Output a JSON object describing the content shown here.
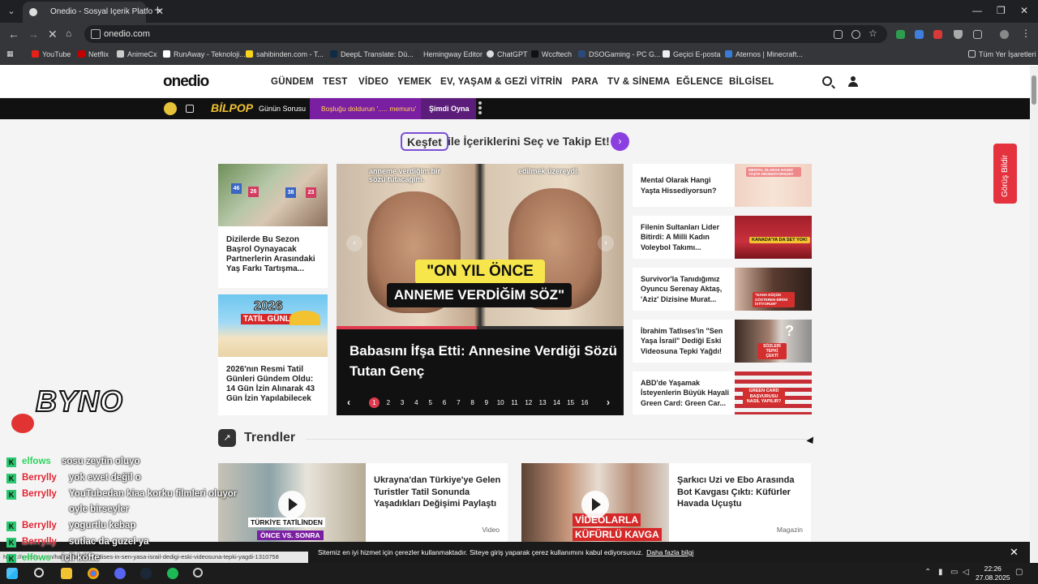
{
  "browser": {
    "tab_title": "Onedio - Sosyal İçerik Platformu",
    "url": "onedio.com",
    "bookmarks": [
      "YouTube",
      "Netflix",
      "AnimeCx",
      "RunAway - Teknoloji...",
      "sahibinden.com - T...",
      "DeepL Translate: Dü...",
      "Hemingway Editor",
      "ChatGPT",
      "Wccftech",
      "DSOGaming - PC G...",
      "Geçici E-posta",
      "Aternos | Minecraft..."
    ],
    "all_bookmarks": "Tüm Yer İşaretleri",
    "status_url": "https://onedio.com/haber/ibrahim-tatlises-in-sen-yasa-israil-dedigi-eski-videosuna-tepki-yagdi-1310758"
  },
  "site": {
    "logo": "onedio",
    "nav": [
      "GÜNDEM",
      "TEST",
      "VİDEO",
      "YEMEK",
      "EV, YAŞAM & GEZİ",
      "VİTRİN",
      "PARA",
      "TV & SİNEMA",
      "EĞLENCE",
      "BİLGİSEL"
    ]
  },
  "promo": {
    "brand": "BİLPOP",
    "question_label": "Günün Sorusu",
    "question_text": "Boşluğu doldurun '..... memuru'",
    "play_label": "Şimdi Oyna"
  },
  "discover": {
    "highlight": "Keşfet",
    "rest": "ile İçeriklerini Seç ve Takip Et!"
  },
  "left_cards": [
    {
      "title": "Dizilerde Bu Sezon Başrol Oynayacak Partnerlerin Arasındaki Yaş Farkı Tartışma...",
      "badges": [
        "46",
        "26",
        "38",
        "23"
      ]
    },
    {
      "title": "2026'nın Resmi Tatil Günleri Gündem Oldu: 14 Gün İzin Alınarak 43 Gün İzin Yapılabilecek",
      "img_title": "2026",
      "img_sub": "TATİL GÜNLERİ"
    }
  ],
  "hero": {
    "top_left": "anneme verdiğim bir sözü tutacağım.",
    "top_right": "edilmek üzereydi.",
    "caption1": "\"ON YIL ÖNCE",
    "caption2": "ANNEME VERDİĞİM SÖZ\"",
    "title": "Babasını İfşa Etti: Annesine Verdiği Sözü Tutan Genç",
    "pages": [
      "1",
      "2",
      "3",
      "4",
      "5",
      "6",
      "7",
      "8",
      "9",
      "10",
      "11",
      "12",
      "13",
      "14",
      "15",
      "16"
    ],
    "progress": 0.49
  },
  "side_cards": [
    {
      "title": "Mental Olarak Hangi Yaşta Hissediyorsun?",
      "tag": "MENTAL OLARAK HANGİ YAŞTA HİSSEDİYORSUN?"
    },
    {
      "title": "Filenin Sultanları Lider Bitirdi: A Milli Kadın Voleybol Takımı...",
      "tag": "KANADA'YA DA SET YOK!"
    },
    {
      "title": "Survivor'la Tanıdığımız Oyuncu Serenay Aktaş, 'Aziz' Dizisine Murat...",
      "tag": "\"DAHA KÜÇÜK GÖSTEREN BİRİNİ İSTİYORUM\""
    },
    {
      "title": "İbrahim Tatlıses'in \"Sen Yaşa İsrail\" Dediği Eski Videosuna Tepki Yağdı!",
      "tag": "SÖZLERİ TEPKİ ÇEKTİ"
    },
    {
      "title": "ABD'de Yaşamak İsteyenlerin Büyük Hayali Green Card: Green Car...",
      "tag": "GREEN CARD BAŞVURUSU NASIL YAPILIR?"
    }
  ],
  "feedback": "Görüş Bildir",
  "trends": {
    "heading": "Trendler",
    "cards": [
      {
        "title": "Ukrayna'dan Türkiye'ye Gelen Turistler Tatil Sonunda Yaşadıkları Değişimi Paylaştı",
        "category": "Video",
        "img_text1": "TÜRKİYE TATİLİNDEN",
        "img_text2": "ÖNCE VS. SONRA"
      },
      {
        "title": "Şarkıcı Uzi ve Ebo Arasında Bot Kavgası Çıktı: Küfürler Havada Uçuştu",
        "category": "Magazin",
        "img_text1": "VİDEOLARLA",
        "img_text2": "KÜFÜRLÜ KAVGA"
      }
    ]
  },
  "cookie": {
    "text": "Sitemiz en iyi hizmet için çerezler kullanmaktadır. Siteye giriş yaparak çerez kullanımını kabul ediyorsunuz.",
    "link": "Daha fazla bilgi"
  },
  "chat": {
    "overlay_logo": "BYNO",
    "lines": [
      {
        "user": "elfows",
        "msg": "sosu zeytin oluyo",
        "user_color": "#2bd15a"
      },
      {
        "user": "Berrylly",
        "msg": "yok ewet değil o",
        "user_color": "#e0212f"
      },
      {
        "user": "Berrylly",
        "msg": "YouTubedan kiaa korku filmleri oluyor",
        "user_color": "#e0212f"
      },
      {
        "user": "",
        "msg": "oyle birseyler",
        "user_color": "#e0212f"
      },
      {
        "user": "Berrylly",
        "msg": "yogurtlu kebap",
        "user_color": "#e0212f"
      },
      {
        "user": "Berrylly",
        "msg": "sutlac da guzel ya",
        "user_color": "#e0212f"
      },
      {
        "user": "elfows",
        "msg": "içli köfte",
        "user_color": "#2bd15a"
      },
      {
        "user": "Berrylly",
        "msg": "döner",
        "user_color": "#e0212f"
      }
    ]
  },
  "taskbar": {
    "time": "22:26",
    "date": "27.08.2025"
  }
}
